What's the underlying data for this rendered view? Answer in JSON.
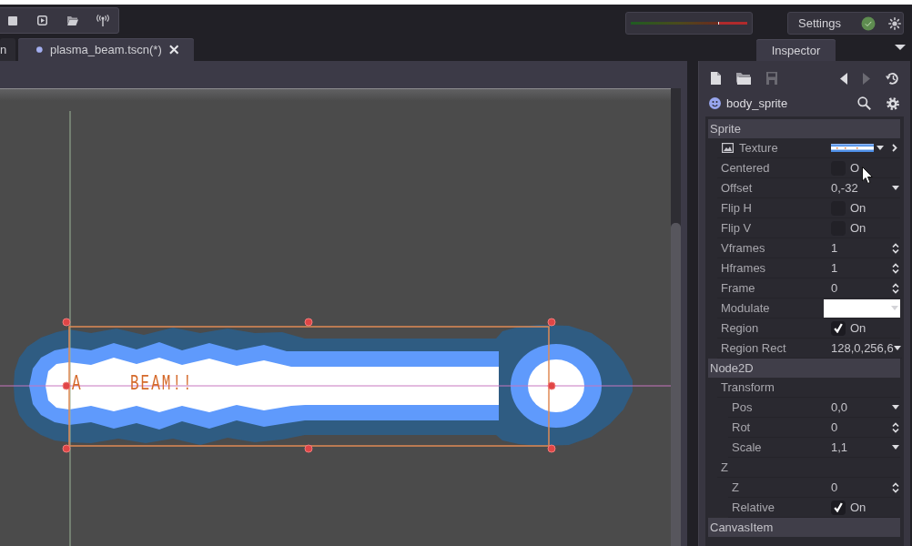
{
  "meter": {
    "level": 0.76
  },
  "settings": {
    "label": "Settings"
  },
  "scene_tabs": [
    {
      "label": "n",
      "selected": false
    },
    {
      "label": "plasma_beam.tscn(*)",
      "selected": true
    }
  ],
  "dock_tabs": [
    {
      "label": "Inspector",
      "selected": true
    }
  ],
  "viewport": {
    "sprite_text": [
      "A",
      "BEAM!!"
    ]
  },
  "inspector": {
    "toolbar": [
      {
        "kind": "new",
        "disabled": false
      },
      {
        "kind": "open",
        "disabled": false
      },
      {
        "kind": "save",
        "disabled": true
      },
      {
        "kind": "back",
        "disabled": false
      },
      {
        "kind": "forward",
        "disabled": true
      },
      {
        "kind": "history",
        "disabled": false
      }
    ],
    "node_name": "body_sprite",
    "sections": [
      {
        "title": "Sprite",
        "properties": [
          {
            "kind": "resource",
            "label": "Texture"
          },
          {
            "kind": "check",
            "label": "Centered",
            "checked": false,
            "text": "O"
          },
          {
            "kind": "vector",
            "label": "Offset",
            "value": "0,-32"
          },
          {
            "kind": "check",
            "label": "Flip H",
            "checked": false,
            "text": "On"
          },
          {
            "kind": "check",
            "label": "Flip V",
            "checked": false,
            "text": "On"
          },
          {
            "kind": "spin",
            "label": "Vframes",
            "value": "1"
          },
          {
            "kind": "spin",
            "label": "Hframes",
            "value": "1"
          },
          {
            "kind": "spin",
            "label": "Frame",
            "value": "0"
          },
          {
            "kind": "color",
            "label": "Modulate",
            "color": "#ffffff"
          },
          {
            "kind": "check",
            "label": "Region",
            "checked": true,
            "text": "On"
          },
          {
            "kind": "vector",
            "label": "Region Rect",
            "value": "128,0,256,6"
          }
        ]
      },
      {
        "title": "Node2D",
        "properties": [
          {
            "kind": "group",
            "label": "Transform",
            "children": [
              {
                "kind": "vector",
                "label": "Pos",
                "value": "0,0"
              },
              {
                "kind": "spin",
                "label": "Rot",
                "value": "0"
              },
              {
                "kind": "vector",
                "label": "Scale",
                "value": "1,1"
              }
            ]
          },
          {
            "kind": "group",
            "label": "Z",
            "children": [
              {
                "kind": "spin",
                "label": "Z",
                "value": "0"
              },
              {
                "kind": "check",
                "label": "Relative",
                "checked": true,
                "text": "On"
              }
            ]
          }
        ]
      },
      {
        "title": "CanvasItem"
      }
    ]
  }
}
